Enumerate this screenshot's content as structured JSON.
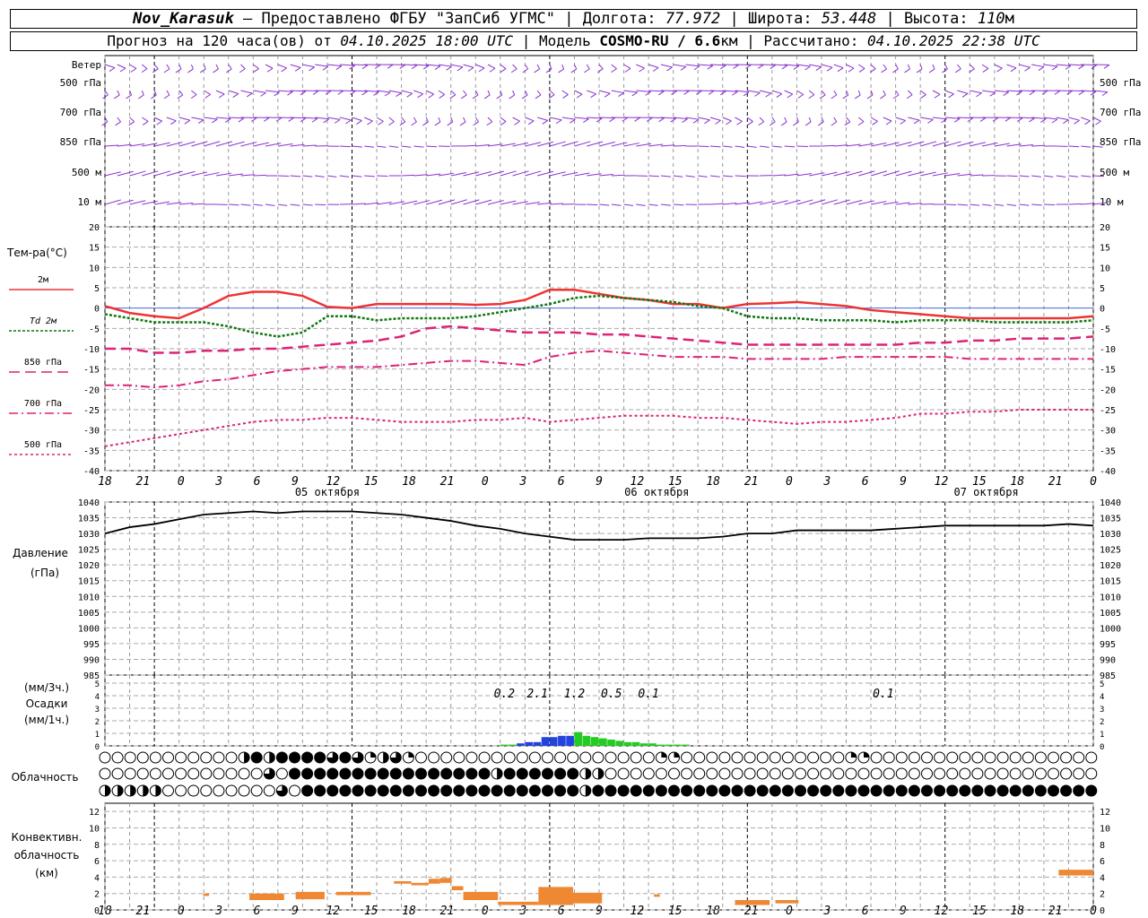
{
  "header": {
    "station": "Nov_Karasuk",
    "provider": " – Предоставлено ФГБУ \"ЗапСиб УГМС\" | Долгота: ",
    "lon": "77.972",
    "lat_label": " | Широта: ",
    "lat": "53.448",
    "alt_label": " | Высота: ",
    "alt": "110",
    "alt_unit": "м",
    "forecast_label": "Прогноз на 120 часа(ов) от ",
    "forecast_time": "04.10.2025 18:00 UTC",
    "model_label": "  | Модель ",
    "model": "COSMO-RU / 6.6",
    "model_unit": "км",
    "calc_label": " | Рассчитано: ",
    "calc_time": "04.10.2025 22:38 UTC"
  },
  "wind_panel": {
    "labels": [
      "Ветер",
      "500 гПа",
      "700 гПа",
      "850 гПа",
      "500 м",
      "10 м"
    ],
    "right_labels": [
      "500 гПа",
      "700 гПа",
      "850 гПа",
      "500 м",
      "10 м"
    ]
  },
  "temp_panel": {
    "title": "Тем-ра(°С)",
    "legend": [
      "2м",
      "Td  2м",
      "850 гПа",
      "700 гПа",
      "500 гПа"
    ],
    "ticks": [
      "20",
      "15",
      "10",
      "5",
      "0",
      "-5",
      "-10",
      "-15",
      "-20",
      "-25",
      "-30",
      "-35",
      "-40"
    ]
  },
  "time_axis": {
    "hours": [
      "18",
      "21",
      "0",
      "3",
      "6",
      "9",
      "12",
      "15",
      "18",
      "21",
      "0",
      "3",
      "6",
      "9",
      "12",
      "15",
      "18",
      "21",
      "0",
      "3",
      "6",
      "9",
      "12",
      "15",
      "18",
      "21",
      "0"
    ],
    "days": [
      "05 октября",
      "06 октября",
      "07 октября"
    ]
  },
  "pressure_panel": {
    "title1": "Давление",
    "title2": "(гПа)",
    "ticks": [
      "1040",
      "1035",
      "1030",
      "1025",
      "1020",
      "1015",
      "1010",
      "1005",
      "1000",
      "995",
      "990",
      "985"
    ]
  },
  "precip_panel": {
    "title1": "(мм/3ч.)",
    "title2": "Осадки",
    "title3": "(мм/1ч.)",
    "ticks": [
      "5",
      "4",
      "3",
      "2",
      "1",
      "0"
    ],
    "labels": [
      "0.2",
      "2.1",
      "1.2",
      "0.5",
      "0.1",
      "0.1"
    ]
  },
  "cloud_panel": {
    "title": "Облачность"
  },
  "conv_panel": {
    "title1": "Конвективн.",
    "title2": "облачность",
    "title3": "(км)",
    "ticks": [
      "12",
      "10",
      "8",
      "6",
      "4",
      "2",
      "0"
    ]
  },
  "colors": {
    "temp2m": "#ee3333",
    "td2m": "#117711",
    "t850": "#dd2277",
    "wind": "#8833cc",
    "rain_heavy": "#2244dd",
    "rain_light": "#22cc22",
    "conv": "#ee8833"
  },
  "chart_data": [
    {
      "type": "line",
      "title": "Тем-ра(°С)",
      "x_hours_from_start": [
        0,
        3,
        6,
        9,
        12,
        15,
        18,
        21,
        24,
        27,
        30,
        33,
        36,
        39,
        42,
        45,
        48,
        51,
        54,
        57,
        60,
        63,
        66,
        69,
        72,
        75,
        78,
        81,
        84,
        87,
        90,
        93,
        96,
        99,
        102,
        105,
        108,
        111,
        114,
        117,
        120
      ],
      "x_start": "04.10.2025 18:00 UTC",
      "ylim": [
        -40,
        20
      ],
      "series": [
        {
          "name": "2м",
          "values": [
            0.5,
            -1.2,
            -2,
            -2.5,
            0,
            3,
            4,
            4,
            3,
            0.3,
            0,
            1,
            1,
            1,
            1,
            0.8,
            1,
            2,
            4.5,
            4.5,
            3.5,
            2.5,
            2,
            1,
            1,
            0,
            1,
            1.2,
            1.5,
            1,
            0.5,
            -0.5,
            -1,
            -1.5,
            -2,
            -2.5,
            -2.5,
            -2.5,
            -2.5,
            -2.5,
            -2
          ]
        },
        {
          "name": "Td  2м",
          "values": [
            -1.5,
            -2.5,
            -3.5,
            -3.5,
            -3.5,
            -4.5,
            -6,
            -7,
            -6,
            -2,
            -2,
            -3,
            -2.5,
            -2.5,
            -2.5,
            -2,
            -1,
            0,
            1,
            2.5,
            3,
            2.5,
            2,
            1.5,
            0.5,
            0,
            -2,
            -2.5,
            -2.5,
            -3,
            -3,
            -3,
            -3.5,
            -3,
            -3,
            -3,
            -3.5,
            -3.5,
            -3.5,
            -3.5,
            -3
          ]
        },
        {
          "name": "850 гПа",
          "values": [
            -10,
            -10,
            -11,
            -11,
            -10.5,
            -10.5,
            -10,
            -10,
            -9.5,
            -9,
            -8.5,
            -8,
            -7,
            -5,
            -4.5,
            -5,
            -5.5,
            -6,
            -6,
            -6,
            -6.5,
            -6.5,
            -7,
            -7.5,
            -8,
            -8.5,
            -9,
            -9,
            -9,
            -9,
            -9,
            -9,
            -9,
            -8.5,
            -8.5,
            -8,
            -8,
            -7.5,
            -7.5,
            -7.5,
            -7
          ]
        },
        {
          "name": "700 гПа",
          "values": [
            -19,
            -19,
            -19.5,
            -19,
            -18,
            -17.5,
            -16.5,
            -15.5,
            -15,
            -14.5,
            -14.5,
            -14.5,
            -14,
            -13.5,
            -13,
            -13,
            -13.5,
            -14,
            -12,
            -11,
            -10.5,
            -11,
            -11.5,
            -12,
            -12,
            -12,
            -12.5,
            -12.5,
            -12.5,
            -12.5,
            -12,
            -12,
            -12,
            -12,
            -12,
            -12.5,
            -12.5,
            -12.5,
            -12.5,
            -12.5,
            -12.5
          ]
        },
        {
          "name": "500 гПа",
          "values": [
            -34,
            -33,
            -32,
            -31,
            -30,
            -29,
            -28,
            -27.5,
            -27.5,
            -27,
            -27,
            -27.5,
            -28,
            -28,
            -28,
            -27.5,
            -27.5,
            -27,
            -28,
            -27.5,
            -27,
            -26.5,
            -26.5,
            -26.5,
            -27,
            -27,
            -27.5,
            -28,
            -28.5,
            -28,
            -28,
            -27.5,
            -27,
            -26,
            -26,
            -25.5,
            -25.5,
            -25,
            -25,
            -25,
            -25
          ]
        }
      ]
    },
    {
      "type": "line",
      "title": "Давление (гПа)",
      "ylim": [
        985,
        1040
      ],
      "series": [
        {
          "name": "Давление",
          "values": [
            1030,
            1032,
            1033,
            1034.5,
            1036,
            1036.5,
            1037,
            1036.5,
            1037,
            1037,
            1037,
            1036.5,
            1036,
            1035,
            1034,
            1032.5,
            1031.5,
            1030,
            1029,
            1028,
            1028,
            1028,
            1028.5,
            1028.5,
            1028.5,
            1029,
            1030,
            1030,
            1031,
            1031,
            1031,
            1031,
            1031.5,
            1032,
            1032.5,
            1032.5,
            1032.5,
            1032.5,
            1032.5,
            1033,
            1032.5
          ]
        }
      ]
    },
    {
      "type": "bar",
      "title": "Осадки (мм/1ч.)",
      "ylim": [
        0,
        5
      ],
      "x_hours_from_start": [
        48,
        49,
        50,
        51,
        52,
        53,
        54,
        55,
        56,
        57,
        58,
        59,
        60,
        61,
        62,
        63,
        64,
        65,
        66,
        67,
        68,
        69,
        70,
        71,
        72
      ],
      "values": [
        0.1,
        0.1,
        0.2,
        0.3,
        0.3,
        0.7,
        0.7,
        0.8,
        0.8,
        1.1,
        0.8,
        0.7,
        0.6,
        0.5,
        0.4,
        0.3,
        0.3,
        0.2,
        0.2,
        0.1,
        0.1,
        0.1,
        0.1,
        0.0,
        0.0
      ],
      "totals_3h": [
        0.2,
        2.1,
        1.2,
        0.5,
        0.1,
        0.1
      ]
    },
    {
      "type": "bar",
      "title": "Конвективн. облачность (км)",
      "ylim": [
        0,
        13
      ],
      "segments": [
        {
          "t0": 17,
          "t1": 18,
          "base": 1.7,
          "top": 2.0
        },
        {
          "t0": 25,
          "t1": 31,
          "base": 1.2,
          "top": 2.0
        },
        {
          "t0": 33,
          "t1": 38,
          "base": 1.3,
          "top": 2.2
        },
        {
          "t0": 40,
          "t1": 46,
          "base": 1.8,
          "top": 2.2
        },
        {
          "t0": 50,
          "t1": 53,
          "base": 3.2,
          "top": 3.5
        },
        {
          "t0": 53,
          "t1": 56,
          "base": 3.0,
          "top": 3.3
        },
        {
          "t0": 56,
          "t1": 58,
          "base": 3.2,
          "top": 3.8
        },
        {
          "t0": 58,
          "t1": 60,
          "base": 3.3,
          "top": 3.9
        },
        {
          "t0": 60,
          "t1": 62,
          "base": 2.4,
          "top": 2.9
        },
        {
          "t0": 62,
          "t1": 68,
          "base": 1.2,
          "top": 2.2
        },
        {
          "t0": 68,
          "t1": 75,
          "base": 0.6,
          "top": 1.0
        },
        {
          "t0": 75,
          "t1": 81,
          "base": 0.6,
          "top": 2.8
        },
        {
          "t0": 81,
          "t1": 86,
          "base": 0.8,
          "top": 2.1
        },
        {
          "t0": 95,
          "t1": 96,
          "base": 1.6,
          "top": 1.9
        },
        {
          "t0": 109,
          "t1": 115,
          "base": 0.6,
          "top": 1.2
        },
        {
          "t0": 116,
          "t1": 120,
          "base": 0.8,
          "top": 1.2
        },
        {
          "t0": 165,
          "t1": 171,
          "base": 4.2,
          "top": 4.9
        }
      ]
    }
  ]
}
